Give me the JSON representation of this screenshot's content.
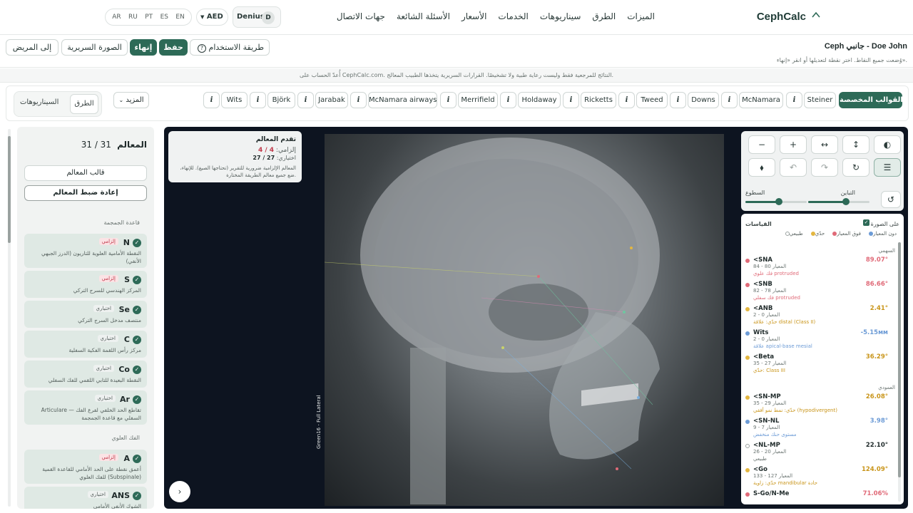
{
  "header": {
    "brand": "CephCalc",
    "nav": [
      "الميزات",
      "الطرق",
      "سيناريوهات",
      "الخدمات",
      "الأسعار",
      "الأسئلة الشائعة",
      "جهات الاتصال"
    ],
    "user_name": "Denius",
    "user_initial": "D",
    "currency": "AED",
    "languages": [
      "AR",
      "RU",
      "PT",
      "ES",
      "EN"
    ]
  },
  "patient": {
    "title": "Ceph جانبي - Doe John",
    "subtitle": "وُضعت جميع النقاط. اختر نقطة لتعديلها أو انقر «إنهاء».",
    "usage_label": "طريقة الاستخدام",
    "save_label": "حفظ",
    "finish_label": "إنهاء",
    "clinical_label": "الصورة السريرية",
    "to_patient_label": "إلى المريض"
  },
  "notice": "أُعدّ الحساب على CephCalc.com. النتائج للمرجعية فقط وليست رعاية طبية ولا تشخيصًا. القرارات السريرية يتخذها الطبيب المعالج.",
  "templates": {
    "tabs": [
      "السيناريوهات",
      "الطرق"
    ],
    "more_label": "المزيد",
    "items": [
      "القوالب المخصصة",
      "Steiner",
      "McNamara",
      "Downs",
      "Tweed",
      "Ricketts",
      "Holdaway",
      "Merrifield",
      "McNamara airways",
      "Jarabak",
      "Björk",
      "Wits"
    ],
    "info_glyph": "i"
  },
  "landmarks_panel": {
    "title": "المعالم",
    "count": "31 / 31",
    "template_label": "قالب المعالم",
    "reset_label": "إعادة ضبط المعالم",
    "section_skull": "قاعدة الجمجمة",
    "section_maxilla": "الفك العلوي",
    "items": [
      {
        "code": "N",
        "tag": "إلزامي",
        "desc": "النقطة الأمامية العلوية للتاريون (الدرز الجبهي الأنفي)"
      },
      {
        "code": "S",
        "tag": "إلزامي",
        "desc": "المركز الهندسي للسرج التركي"
      },
      {
        "code": "Se",
        "tag": "اختياري",
        "desc": "منتصف مدخل السرج التركي"
      },
      {
        "code": "C",
        "tag": "اختياري",
        "desc": "مركز رأس اللقمة الفكية السفلية"
      },
      {
        "code": "Co",
        "tag": "اختياري",
        "desc": "النقطة البعيدة للتابي اللقمي للفك السفلي"
      },
      {
        "code": "Ar",
        "tag": "اختياري",
        "desc": "Articulare — تقاطع الحد الخلفي لفرع الفك السفلي مع قاعدة الجمجمة"
      },
      {
        "code": "A",
        "tag": "إلزامي",
        "desc": "أعمق نقطة على الحد الأمامي للقاعدة القمية للفك العلوي (Subspinale)"
      },
      {
        "code": "ANS",
        "tag": "اختياري",
        "desc": "الشوك الأنفي الأمامي"
      }
    ]
  },
  "progress_card": {
    "title": "تقدم المعالم",
    "required_label": "إلزامي:",
    "required_value": "4 / 4",
    "optional_label": "اختياري:",
    "optional_value": "27 / 27",
    "note": "المعالم الإلزامية ضرورية للتقرير (تحتاجها الصيغ). للإنهاء، ضع جميع معالم الطريقة المختارة."
  },
  "tools": {
    "buttons": [
      "◐",
      "↕",
      "↔",
      "+",
      "−",
      "☰",
      "↻",
      "↷",
      "↶",
      "⬧"
    ],
    "contrast_label": "التباين",
    "brightness_label": "السطوع",
    "contrast_level": 0.62,
    "brightness_level": 0.55
  },
  "xray_label": "Green16 - Full Lateral",
  "measurements": {
    "title": "القياسات",
    "on_image_label": "على الصورة",
    "legend": [
      {
        "label": "دون المعيار",
        "color": "#6c9bd6"
      },
      {
        "label": "فوق المعيار",
        "color": "#e06a78"
      },
      {
        "label": "حدّي",
        "color": "#e3b641"
      },
      {
        "label": "طبيعي",
        "color": "#ffffff"
      }
    ],
    "group_sagittal": "السهمي",
    "group_vertical": "العمودي",
    "rows": [
      {
        "name": "<SNA",
        "value": "89.07°",
        "norm": "المعيار 80 - 84",
        "interp": "فك علوي protruded",
        "color": "#e06a78"
      },
      {
        "name": "<SNB",
        "value": "86.66°",
        "norm": "المعيار 78 - 82",
        "interp": "فك سفلي protruded",
        "color": "#e06a78"
      },
      {
        "name": "<ANB",
        "value": "2.41°",
        "norm": "المعيار 0 - 2",
        "interp": "حدّي: علاقة distal (Class II)",
        "color": "#e3b641"
      },
      {
        "name": "Wits",
        "value": "-5.15мм",
        "norm": "المعيار 0 - 2",
        "interp": "علاقة apical-base mesial",
        "color": "#6c9bd6"
      },
      {
        "name": "<Beta",
        "value": "36.29°",
        "norm": "المعيار 27 - 35",
        "interp": "حدّي: Class III",
        "color": "#e3b641"
      },
      {
        "name": "<SN-MP",
        "value": "26.08°",
        "norm": "المعيار 29 - 35",
        "interp": "حدّي: نمط نمو أفقي (hypodivergent)",
        "color": "#e3b641"
      },
      {
        "name": "<SN-NL",
        "value": "3.98°",
        "norm": "المعيار 7 - 9",
        "interp": "مستوى حنك منخفض",
        "color": "#6c9bd6"
      },
      {
        "name": "<NL-MP",
        "value": "22.10°",
        "norm": "المعيار 20 - 26",
        "interp": "طبيعي",
        "color": "#ffffff"
      },
      {
        "name": "<Go",
        "value": "124.09°",
        "norm": "المعيار 127 - 133",
        "interp": "حدّي: زاوية mandibular حادة",
        "color": "#e3b641"
      },
      {
        "name": "S-Go/N-Me",
        "value": "71.06%",
        "norm": "",
        "interp": "",
        "color": "#e06a78"
      }
    ]
  },
  "pager_glyph": "›"
}
